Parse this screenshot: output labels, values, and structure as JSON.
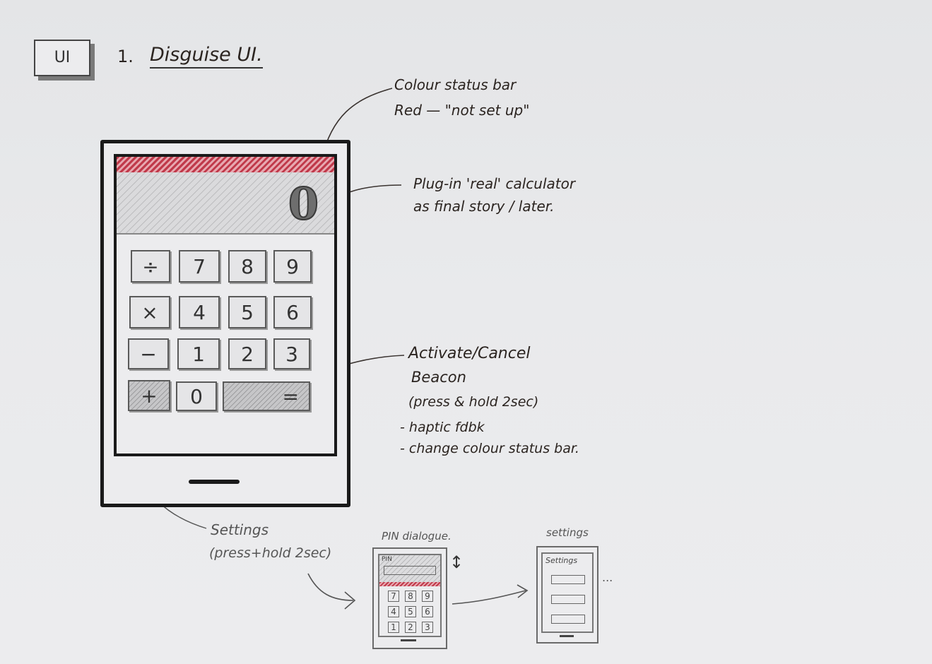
{
  "header": {
    "tag": "UI",
    "number": "1.",
    "title": "Disguise UI."
  },
  "annotations": {
    "status_bar": [
      "Colour status bar",
      "Red — \"not set up\""
    ],
    "calculator": [
      "Plug-in 'real' calculator",
      "as final story / later."
    ],
    "beacon": [
      "Activate/Cancel",
      "Beacon",
      "(press & hold 2sec)",
      "- haptic fdbk",
      "- change colour status bar."
    ],
    "settings": [
      "Settings",
      "(press+hold 2sec)"
    ]
  },
  "calculator": {
    "display_value": "0",
    "status_color": "#c0394a",
    "keys": {
      "divide": "÷",
      "seven": "7",
      "eight": "8",
      "nine": "9",
      "multiply": "×",
      "four": "4",
      "five": "5",
      "six": "6",
      "minus": "−",
      "one": "1",
      "two": "2",
      "three": "3",
      "plus": "+",
      "zero": "0",
      "equals": "="
    }
  },
  "pin_dialogue": {
    "caption": "PIN dialogue.",
    "label": "PIN",
    "arrow": "↕",
    "keys": [
      "7",
      "8",
      "9",
      "4",
      "5",
      "6",
      "1",
      "2",
      "3"
    ]
  },
  "settings_screen": {
    "caption": "settings",
    "title": "Settings",
    "ellipsis": "..."
  }
}
